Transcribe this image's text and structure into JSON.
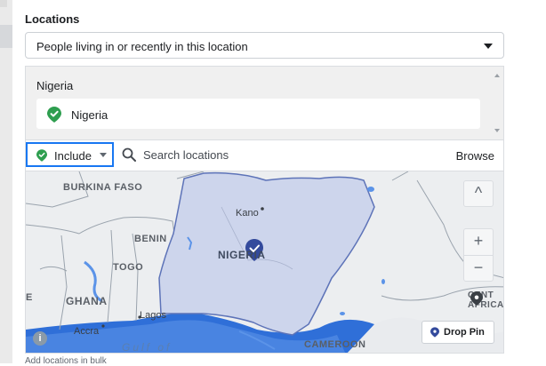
{
  "locations": {
    "label": "Locations",
    "audience_type": "People living in or recently in this location",
    "selected_group": "Nigeria",
    "selected_items": [
      {
        "name": "Nigeria",
        "icon": "green-location-pin-icon"
      }
    ]
  },
  "search": {
    "mode": "Include",
    "placeholder": "Search locations",
    "browse_label": "Browse"
  },
  "map": {
    "labels": {
      "burkina_faso": "BURKINA FASO",
      "benin": "BENIN",
      "togo": "TOGO",
      "ghana": "GHANA",
      "nigeria": "NIGERIA",
      "kano": "Kano",
      "lagos": "Lagos",
      "accra": "Accra",
      "gulf": "Gulf of",
      "cameroon": "CAMEROON",
      "central_africa": "CENT AFRICA",
      "cut_left": "E"
    },
    "controls": {
      "collapse": "^",
      "zoom_in": "+",
      "zoom_out": "−"
    },
    "drop_pin_label": "Drop Pin",
    "accent": "#1877f2",
    "pin_color": "#2e9e4f",
    "marker_color": "#334a9c"
  },
  "footer": {
    "bulk_label": "Add locations in bulk"
  }
}
